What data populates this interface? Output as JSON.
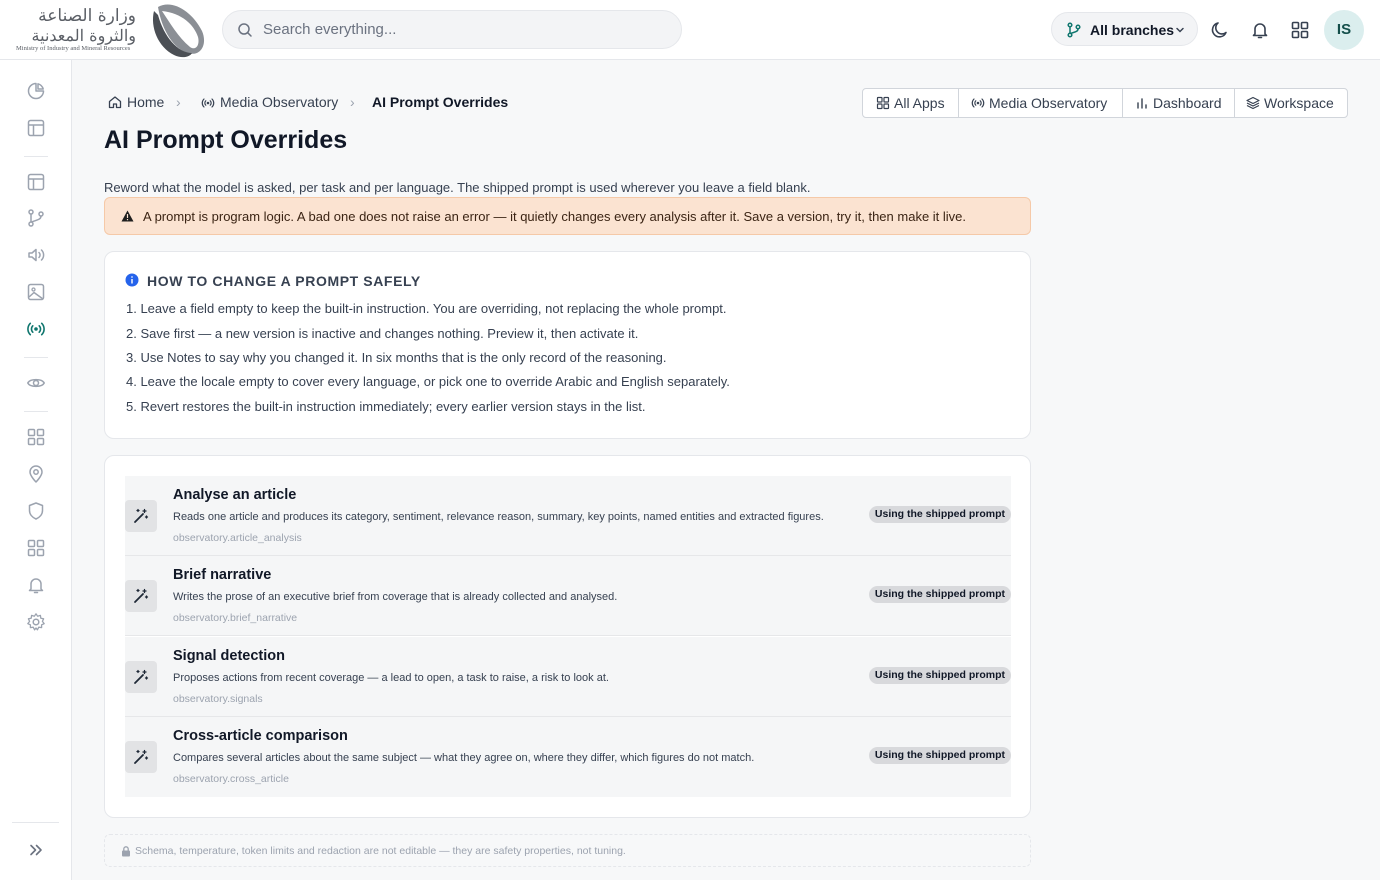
{
  "brand": {
    "arabic_line1": "وزارة الصناعة",
    "arabic_line2": "والثروة المعدنية",
    "english_name": "Ministry of Industry and Mineral Resources",
    "logo_icon": "ribbon-logo-icon"
  },
  "header": {
    "search_placeholder": "Search everything...",
    "branch_selector": "All branches",
    "avatar_initials": "IS",
    "icons": [
      "git-branch-icon",
      "chevron-down-icon",
      "moon-icon",
      "bell-icon",
      "apps-grid-icon"
    ]
  },
  "sidebar": {
    "icons": [
      "pie-chart-icon",
      "layout-icon",
      "layout-icon",
      "git-branch-icon",
      "speaker-icon",
      "image-icon",
      "broadcast-icon",
      "eye-icon",
      "apps-grid-icon",
      "map-pin-icon",
      "shield-icon",
      "apps-grid-icon",
      "bell-icon",
      "gear-icon",
      "chevrons-right-icon"
    ],
    "active_icon": "broadcast-icon"
  },
  "breadcrumb": {
    "home": "Home",
    "section": "Media Observatory",
    "current": "AI Prompt Overrides"
  },
  "app_switcher": {
    "all_apps": "All Apps",
    "media_observatory": "Media Observatory",
    "dashboard": "Dashboard",
    "workspace": "Workspace"
  },
  "page": {
    "title": "AI Prompt Overrides",
    "intro": "Reword what the model is asked, per task and per language. The shipped prompt is used wherever you leave a field blank.",
    "warning": "A prompt is program logic. A bad one does not raise an error — it quietly changes every analysis after it. Save a version, try it, then make it live."
  },
  "howto": {
    "title": "HOW TO CHANGE A PROMPT SAFELY",
    "steps": [
      "1. Leave a field empty to keep the built-in instruction. You are overriding, not replacing the whole prompt.",
      "2. Save first — a new version is inactive and changes nothing. Preview it, then activate it.",
      "3. Use Notes to say why you changed it. In six months that is the only record of the reasoning.",
      "4. Leave the locale empty to cover every language, or pick one to override Arabic and English separately.",
      "5. Revert restores the built-in instruction immediately; every earlier version stays in the list."
    ]
  },
  "tasks": [
    {
      "title": "Analyse an article",
      "description": "Reads one article and produces its category, sentiment, relevance reason, summary, key points, named entities and extracted figures.",
      "key": "observatory.article_analysis",
      "status": "Using the shipped prompt"
    },
    {
      "title": "Brief narrative",
      "description": "Writes the prose of an executive brief from coverage that is already collected and analysed.",
      "key": "observatory.brief_narrative",
      "status": "Using the shipped prompt"
    },
    {
      "title": "Signal detection",
      "description": "Proposes actions from recent coverage — a lead to open, a task to raise, a risk to look at.",
      "key": "observatory.signals",
      "status": "Using the shipped prompt"
    },
    {
      "title": "Cross-article comparison",
      "description": "Compares several articles about the same subject — what they agree on, where they differ, which figures do not match.",
      "key": "observatory.cross_article",
      "status": "Using the shipped prompt"
    }
  ],
  "footnote": "Schema, temperature, token limits and redaction are not editable — they are safety properties, not tuning.",
  "colors": {
    "accent": "#0f766e",
    "warning_bg": "#fbe3d1",
    "info_icon": "#2563eb",
    "avatar_bg": "#dbeeee"
  }
}
